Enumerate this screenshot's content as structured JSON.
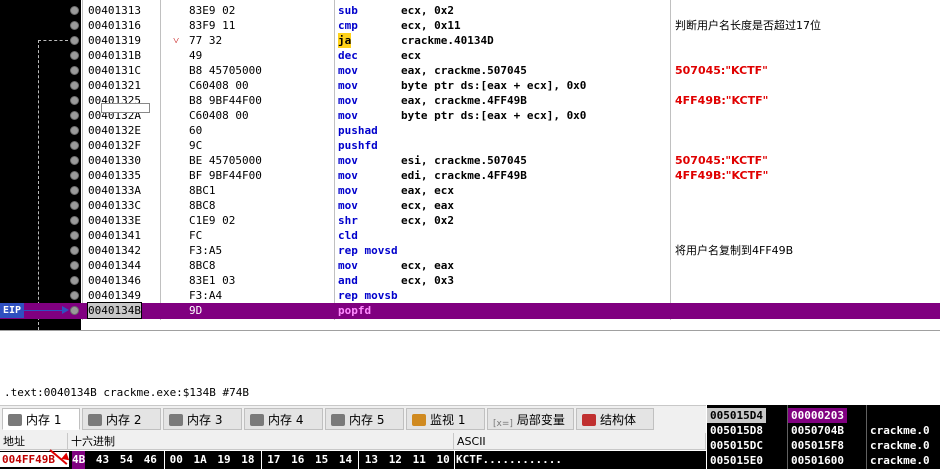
{
  "disasm": {
    "rows": [
      {
        "addr": "00401313",
        "arrow": "",
        "hex": "83E9 02",
        "mn": "sub",
        "ops": "ecx, 0x2",
        "comment": "",
        "comment_color": "#000000",
        "highlight": false,
        "eip": false
      },
      {
        "addr": "00401316",
        "arrow": "",
        "hex": "83F9 11",
        "mn": "cmp",
        "ops": "ecx, 0x11",
        "comment": "判断用户名长度是否超过17位",
        "comment_color": "#000000",
        "highlight": false,
        "eip": false
      },
      {
        "addr": "00401319",
        "arrow": "˅",
        "hex": "77 32",
        "mn": "ja",
        "ops": "crackme.40134D",
        "comment": "",
        "comment_color": "#000000",
        "highlight": true,
        "eip": false
      },
      {
        "addr": "0040131B",
        "arrow": "",
        "hex": "49",
        "mn": "dec",
        "ops": "ecx",
        "comment": "",
        "comment_color": "#000000",
        "highlight": false,
        "eip": false
      },
      {
        "addr": "0040131C",
        "arrow": "",
        "hex": "B8 45705000",
        "mn": "mov",
        "ops": "eax, crackme.507045",
        "comment": "507045:\"KCTF\"",
        "comment_color": "#e00000",
        "highlight": false,
        "eip": false
      },
      {
        "addr": "00401321",
        "arrow": "",
        "hex": "C60408 00",
        "mn": "mov",
        "ops": "byte ptr ds:[eax + ecx], 0x0",
        "comment": "",
        "comment_color": "#000000",
        "highlight": false,
        "eip": false
      },
      {
        "addr": "00401325",
        "arrow": "",
        "hex": "B8 9BF44F00",
        "mn": "mov",
        "ops": "eax, crackme.4FF49B",
        "comment": "4FF49B:\"KCTF\"",
        "comment_color": "#e00000",
        "highlight": false,
        "eip": false
      },
      {
        "addr": "0040132A",
        "arrow": "",
        "hex": "C60408 00",
        "mn": "mov",
        "ops": "byte ptr ds:[eax + ecx], 0x0",
        "comment": "",
        "comment_color": "#000000",
        "highlight": false,
        "eip": false
      },
      {
        "addr": "0040132E",
        "arrow": "",
        "hex": "60",
        "mn": "pushad",
        "ops": "",
        "comment": "",
        "comment_color": "#000000",
        "highlight": false,
        "eip": false
      },
      {
        "addr": "0040132F",
        "arrow": "",
        "hex": "9C",
        "mn": "pushfd",
        "ops": "",
        "comment": "",
        "comment_color": "#000000",
        "highlight": false,
        "eip": false
      },
      {
        "addr": "00401330",
        "arrow": "",
        "hex": "BE 45705000",
        "mn": "mov",
        "ops": "esi, crackme.507045",
        "comment": "507045:\"KCTF\"",
        "comment_color": "#e00000",
        "highlight": false,
        "eip": false
      },
      {
        "addr": "00401335",
        "arrow": "",
        "hex": "BF 9BF44F00",
        "mn": "mov",
        "ops": "edi, crackme.4FF49B",
        "comment": "4FF49B:\"KCTF\"",
        "comment_color": "#e00000",
        "highlight": false,
        "eip": false
      },
      {
        "addr": "0040133A",
        "arrow": "",
        "hex": "8BC1",
        "mn": "mov",
        "ops": "eax, ecx",
        "comment": "",
        "comment_color": "#000000",
        "highlight": false,
        "eip": false
      },
      {
        "addr": "0040133C",
        "arrow": "",
        "hex": "8BC8",
        "mn": "mov",
        "ops": "ecx, eax",
        "comment": "",
        "comment_color": "#000000",
        "highlight": false,
        "eip": false
      },
      {
        "addr": "0040133E",
        "arrow": "",
        "hex": "C1E9 02",
        "mn": "shr",
        "ops": "ecx, 0x2",
        "comment": "",
        "comment_color": "#000000",
        "highlight": false,
        "eip": false
      },
      {
        "addr": "00401341",
        "arrow": "",
        "hex": "FC",
        "mn": "cld",
        "ops": "",
        "comment": "",
        "comment_color": "#000000",
        "highlight": false,
        "eip": false
      },
      {
        "addr": "00401342",
        "arrow": "",
        "hex": "F3:A5",
        "mn": "rep movsd",
        "ops": "",
        "comment": "将用户名复制到4FF49B",
        "comment_color": "#000000",
        "highlight": false,
        "eip": false
      },
      {
        "addr": "00401344",
        "arrow": "",
        "hex": "8BC8",
        "mn": "mov",
        "ops": "ecx, eax",
        "comment": "",
        "comment_color": "#000000",
        "highlight": false,
        "eip": false
      },
      {
        "addr": "00401346",
        "arrow": "",
        "hex": "83E1 03",
        "mn": "and",
        "ops": "ecx, 0x3",
        "comment": "",
        "comment_color": "#000000",
        "highlight": false,
        "eip": false
      },
      {
        "addr": "00401349",
        "arrow": "",
        "hex": "F3:A4",
        "mn": "rep movsb",
        "ops": "",
        "comment": "",
        "comment_color": "#000000",
        "highlight": false,
        "eip": false
      },
      {
        "addr": "0040134B",
        "arrow": "",
        "hex": "9D",
        "mn": "popfd",
        "ops": "",
        "comment": "",
        "comment_color": "#000000",
        "highlight": false,
        "eip": true
      }
    ],
    "eip_label": "EIP"
  },
  "info": {
    "text": ".text:0040134B crackme.exe:$134B #74B"
  },
  "tabs": [
    {
      "label": "内存 1",
      "icon_color": "#7a7a7a",
      "active": true
    },
    {
      "label": "内存 2",
      "icon_color": "#7a7a7a",
      "active": false
    },
    {
      "label": "内存 3",
      "icon_color": "#7a7a7a",
      "active": false
    },
    {
      "label": "内存 4",
      "icon_color": "#7a7a7a",
      "active": false
    },
    {
      "label": "内存 5",
      "icon_color": "#7a7a7a",
      "active": false
    },
    {
      "label": "监视 1",
      "icon_color": "#d08a20",
      "active": false
    },
    {
      "label": "局部变量",
      "icon_prefix": "[x=]",
      "icon_color": "#7a7a7a",
      "active": false
    },
    {
      "label": "结构体",
      "icon_color": "#c03030",
      "active": false
    }
  ],
  "dump": {
    "headers": {
      "address": "地址",
      "hex": "十六进制",
      "ascii": "ASCII"
    },
    "row": {
      "address": "004FF49B",
      "bytes": [
        "4B",
        "43",
        "54",
        "46",
        "00",
        "1A",
        "19",
        "18",
        "17",
        "16",
        "15",
        "14",
        "13",
        "12",
        "11",
        "10"
      ],
      "ascii": "KCTF............"
    }
  },
  "stack": {
    "rows": [
      {
        "addr": "005015D4",
        "value": "00000203",
        "comment": ""
      },
      {
        "addr": "005015D8",
        "value": "0050704B",
        "comment": "crackme.0"
      },
      {
        "addr": "005015DC",
        "value": "005015F8",
        "comment": "crackme.0"
      },
      {
        "addr": "005015E0",
        "value": "00501600",
        "comment": "crackme.0"
      }
    ]
  },
  "colors": {
    "eip_row": "#800080",
    "mnemonic": "#0000cc",
    "jump_highlight": "#ffd21a",
    "comment_string": "#e00000"
  }
}
